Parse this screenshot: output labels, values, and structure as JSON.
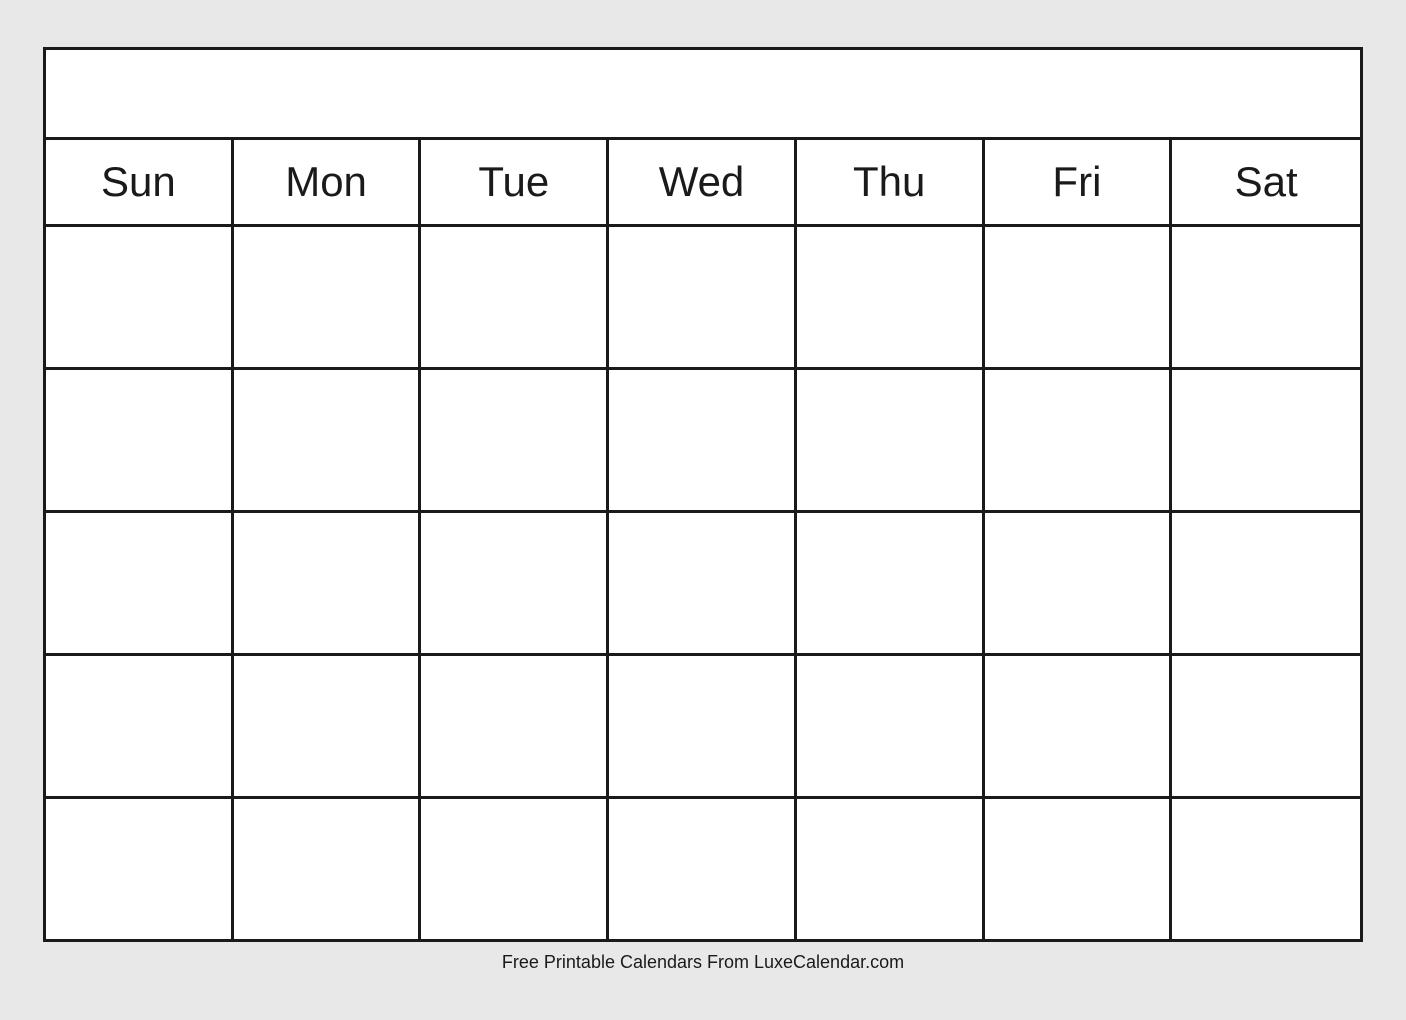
{
  "calendar": {
    "title": "",
    "days": [
      "Sun",
      "Mon",
      "Tue",
      "Wed",
      "Thu",
      "Fri",
      "Sat"
    ],
    "weeks": 5
  },
  "footer": {
    "text": "Free Printable Calendars From LuxeCalendar.com"
  }
}
